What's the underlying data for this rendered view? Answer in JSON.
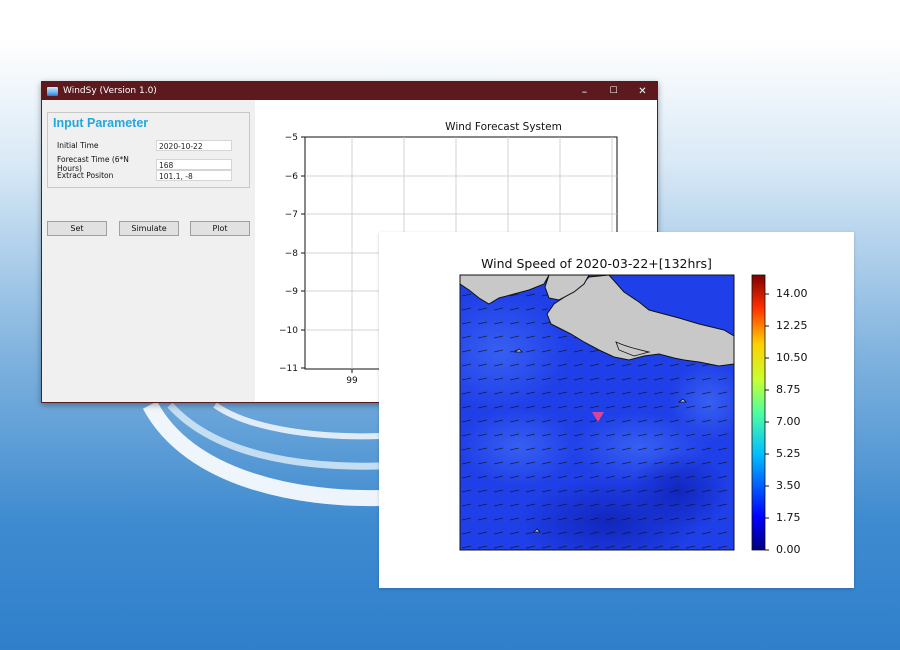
{
  "window": {
    "title": "WindSy (Version 1.0)",
    "buttons": {
      "minimize": "–",
      "maximize": "☐",
      "close": "✕"
    }
  },
  "input_panel": {
    "title": "Input Parameter",
    "fields": [
      {
        "label": "Initial Time",
        "value": "2020-10-22"
      },
      {
        "label": "Forecast Time (6*N Hours)",
        "value": "168"
      },
      {
        "label": "Extract Positon",
        "value": "101.1, -8"
      }
    ],
    "buttons": {
      "set": "Set",
      "simulate": "Simulate",
      "plot": "Plot"
    }
  },
  "forecast_plot": {
    "title": "Wind Forecast System",
    "y_ticks": [
      "−5",
      "−6",
      "−7",
      "−8",
      "−9",
      "−10",
      "−11"
    ],
    "x_ticks": [
      "99"
    ]
  },
  "wind_figure": {
    "title": "Wind Speed of 2020-03-22+[132hrs]",
    "colorbar_ticks": [
      "14.00",
      "12.25",
      "10.50",
      "8.75",
      "7.00",
      "5.25",
      "3.50",
      "1.75",
      "0.00"
    ],
    "colors": {
      "ocean": "#1f3fe8",
      "land": "#c8c8c8",
      "marker": "#d9449a"
    }
  }
}
